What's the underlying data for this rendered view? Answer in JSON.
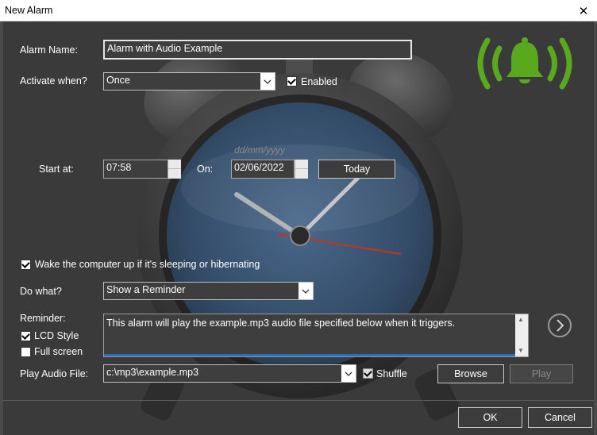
{
  "window": {
    "title": "New Alarm",
    "close_glyph": "✕"
  },
  "colors": {
    "bell_green": "#5aa81e",
    "clock_face": "#3d5f86",
    "second_hand": "#b33a2a",
    "memo_focus": "#2a6fb6"
  },
  "icons": {
    "bell": "bell-ringing-icon",
    "next": "chevron-circle-right-icon"
  },
  "alarm_name": {
    "label": "Alarm Name:",
    "value": "Alarm with Audio Example"
  },
  "activate": {
    "label": "Activate when?",
    "value": "Once"
  },
  "enabled": {
    "label": "Enabled",
    "checked": true
  },
  "date_hint": "dd/mm/yyyy",
  "start": {
    "label": "Start at:",
    "time": "07:58",
    "on_label": "On:",
    "date": "02/06/2022",
    "today_button": "Today"
  },
  "wake": {
    "label": "Wake the computer up if it's sleeping or hibernating",
    "checked": true
  },
  "do_what": {
    "label": "Do what?",
    "value": "Show a Reminder"
  },
  "reminder": {
    "label": "Reminder:",
    "text": "This alarm will play the example.mp3 audio file specified below when it triggers.",
    "lcd_style": {
      "label": "LCD Style",
      "checked": true
    },
    "full_screen": {
      "label": "Full screen",
      "checked": false
    }
  },
  "audio": {
    "label": "Play Audio File:",
    "path": "c:\\mp3\\example.mp3",
    "shuffle": {
      "label": "Shuffle",
      "checked": true
    },
    "browse_button": "Browse",
    "play_button": "Play"
  },
  "footer": {
    "ok_button": "OK",
    "cancel_button": "Cancel"
  }
}
